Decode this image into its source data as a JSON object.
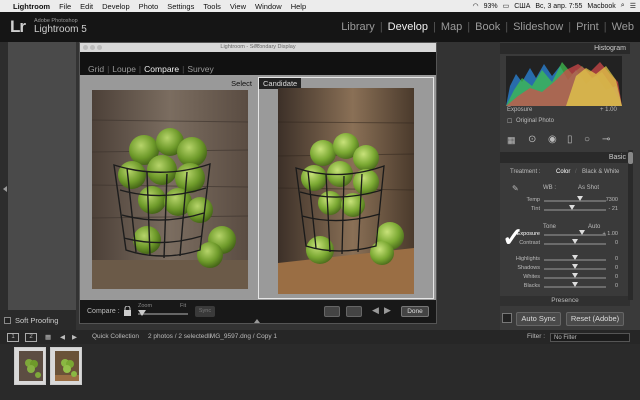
{
  "menubar": {
    "apple_glyph": "",
    "items": [
      "Lightroom",
      "File",
      "Edit",
      "Develop",
      "Photo",
      "Settings",
      "Tools",
      "View",
      "Window",
      "Help"
    ],
    "status": {
      "battery": "93%",
      "keyboard": "США",
      "datetime": "Вс, 3 апр.  7:55",
      "user": "Macbook"
    }
  },
  "app": {
    "logo": "Lr",
    "vendor": "Adobe Photoshop",
    "name": "Lightroom 5",
    "modules": [
      "Library",
      "Develop",
      "Map",
      "Book",
      "Slideshow",
      "Print",
      "Web"
    ],
    "active_module": "Develop"
  },
  "secondary_window": {
    "title": "Lightroom - Secondary Display",
    "view_tabs": [
      "Grid",
      "Loupe",
      "Compare",
      "Survey"
    ],
    "active_tab": "Compare",
    "select_label": "Select",
    "candidate_label": "Candidate",
    "compare_label": "Compare :",
    "zoom_label": "Zoom",
    "fit_label": "Fit",
    "sync_label": "Sync",
    "done_label": "Done"
  },
  "left_panel": {
    "soft_proofing": "Soft Proofing"
  },
  "right_panel": {
    "histogram_title": "Histogram",
    "histogram_readout": "Exposure",
    "histogram_value": "+ 1.00",
    "original_photo": "Original Photo",
    "basic_title": "Basic",
    "treatment_label": "Treatment :",
    "color_label": "Color",
    "bw_label": "Black & White",
    "wb_label": "WB :",
    "wb_value": "As Shot",
    "tone_label": "Tone",
    "tone_auto": "Auto",
    "sliders": [
      {
        "label": "Temp",
        "value": "7300",
        "pos": 0.58
      },
      {
        "label": "Tint",
        "value": "- 21",
        "pos": 0.45
      },
      {
        "label": "Exposure",
        "value": "+ 1.00",
        "pos": 0.62
      },
      {
        "label": "Contrast",
        "value": "0",
        "pos": 0.5
      },
      {
        "label": "Highlights",
        "value": "0",
        "pos": 0.5
      },
      {
        "label": "Shadows",
        "value": "0",
        "pos": 0.5
      },
      {
        "label": "Whites",
        "value": "0",
        "pos": 0.5
      },
      {
        "label": "Blacks",
        "value": "0",
        "pos": 0.5
      }
    ],
    "presence_label": "Presence",
    "auto_sync": "Auto Sync",
    "reset": "Reset (Adobe)"
  },
  "filmstrip": {
    "view1": "1",
    "view2": "2",
    "collection": "Quick Collection",
    "selection_info": "2 photos / 2 selected /",
    "filename": "IMG_9597.dng / Copy 1",
    "filter_label": "Filter :",
    "filter_value": "No Filter"
  }
}
